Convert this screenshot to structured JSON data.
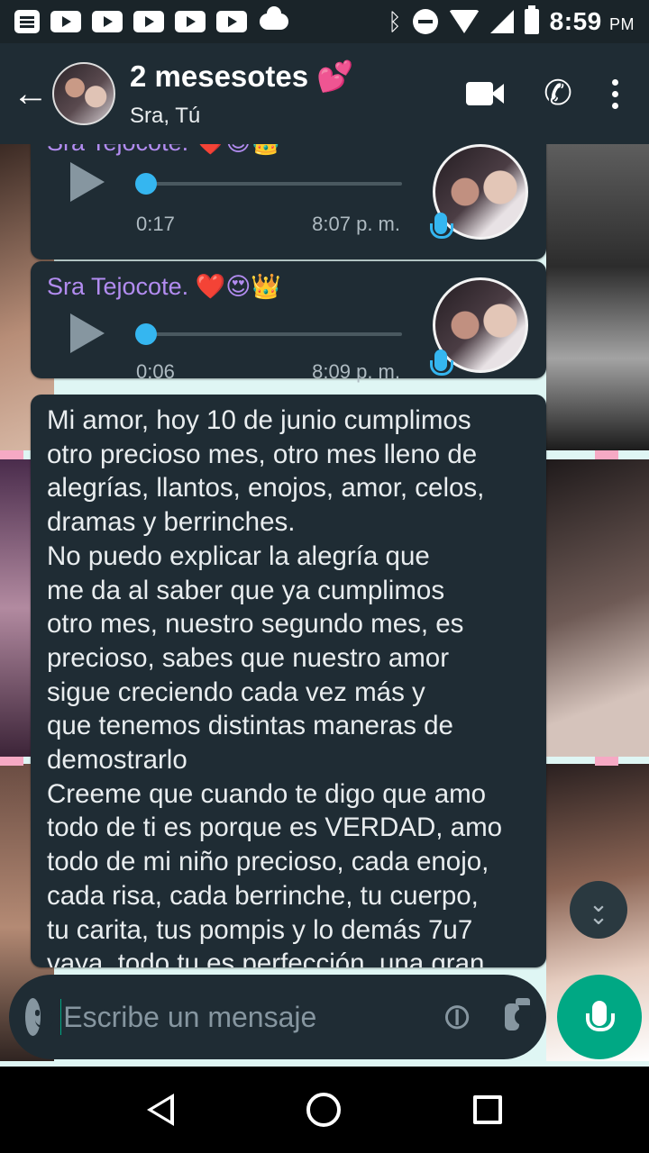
{
  "status_bar": {
    "time": "8:59",
    "ampm": "PM",
    "left_icons": [
      "notes-icon",
      "youtube-icon",
      "youtube-icon",
      "youtube-icon",
      "youtube-icon",
      "youtube-icon",
      "cloud-icon"
    ],
    "right_icons": [
      "bluetooth-icon",
      "do-not-disturb-icon",
      "wifi-icon",
      "signal-icon",
      "battery-icon"
    ]
  },
  "header": {
    "title": "2 mesesotes 💕",
    "subtitle": "Sra, Tú",
    "actions": [
      "video-call-icon",
      "phone-call-icon",
      "more-options-icon"
    ]
  },
  "messages": [
    {
      "type": "voice",
      "sender": "Sra Tejocote. ❤️😍👑",
      "duration": "0:17",
      "time": "8:07 p. m.",
      "progress": 0
    },
    {
      "type": "voice",
      "sender": "Sra Tejocote. ❤️😍👑",
      "duration": "0:06",
      "time": "8:09 p. m.",
      "progress": 0
    },
    {
      "type": "text",
      "text": "Mi amor, hoy 10 de junio cumplimos\notro precioso mes, otro mes lleno de\nalegrías, llantos, enojos, amor, celos,\ndramas y berrinches.\nNo puedo explicar la alegría que\nme da al saber que ya cumplimos\notro mes, nuestro segundo mes, es\nprecioso, sabes que nuestro amor\nsigue creciendo cada vez más y\nque tenemos distintas maneras de\ndemostrarlo\nCreeme que cuando te digo que amo\ntodo de ti es porque es VERDAD, amo\ntodo de mi niño precioso, cada enojo,\ncada risa, cada berrinche, tu cuerpo,\ntu carita, tus pompis y lo demás 7u7\nvaya, todo tu es perfección, una gran"
    }
  ],
  "composer": {
    "placeholder": "Escribe un mensaje"
  },
  "colors": {
    "accent": "#00a884",
    "sender_name": "#b28cf0",
    "voice_progress": "#35b6f0",
    "bubble": "#1f2c34"
  }
}
